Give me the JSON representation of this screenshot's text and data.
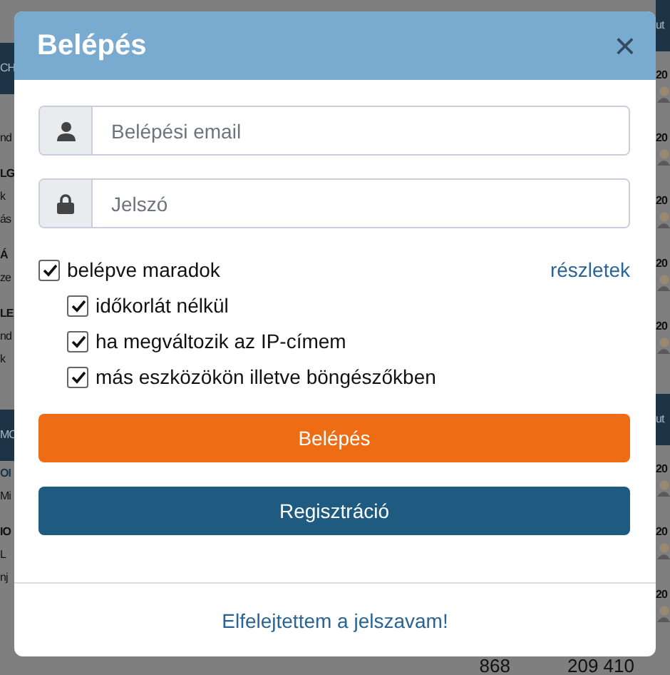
{
  "background": {
    "left": [
      {
        "kind": "header",
        "text": "CH"
      },
      {
        "kind": "line",
        "text": "nd"
      },
      {
        "kind": "title",
        "text": "LG"
      },
      {
        "kind": "line",
        "text": "k"
      },
      {
        "kind": "line",
        "text": "ás"
      },
      {
        "kind": "title",
        "text": "Á"
      },
      {
        "kind": "line",
        "text": "ze"
      },
      {
        "kind": "title",
        "text": "LE"
      },
      {
        "kind": "line",
        "text": "nd"
      },
      {
        "kind": "line",
        "text": "k"
      },
      {
        "kind": "header",
        "text": "MC"
      },
      {
        "kind": "link",
        "text": "OI"
      },
      {
        "kind": "line",
        "text": "Mi"
      },
      {
        "kind": "title",
        "text": "IO"
      },
      {
        "kind": "line",
        "text": "L"
      },
      {
        "kind": "line",
        "text": "nj"
      }
    ],
    "right": [
      {
        "kind": "header",
        "text": "ut"
      },
      {
        "kind": "entry",
        "text": "20"
      },
      {
        "kind": "entry",
        "text": "20"
      },
      {
        "kind": "entry",
        "text": "20"
      },
      {
        "kind": "entry",
        "text": "20"
      },
      {
        "kind": "entry",
        "text": "20"
      },
      {
        "kind": "header",
        "text": "ut"
      },
      {
        "kind": "entry",
        "text": "20"
      },
      {
        "kind": "entry",
        "text": "20"
      },
      {
        "kind": "entry",
        "text": "20"
      }
    ],
    "footer_numbers": [
      "868",
      "209 410"
    ]
  },
  "dialog": {
    "title": "Belépés",
    "close": "×",
    "fields": [
      {
        "kind": "user",
        "placeholder": "Belépési email"
      },
      {
        "kind": "lock",
        "placeholder": "Jelszó"
      }
    ],
    "remember": {
      "label": "belépve maradok",
      "checked": true,
      "details_link": "részletek",
      "options": [
        {
          "label": "időkorlát nélkül",
          "checked": true
        },
        {
          "label": "ha megváltozik az IP-címem",
          "checked": true
        },
        {
          "label": "más eszközökön illetve böngészőkben",
          "checked": true
        }
      ]
    },
    "buttons": [
      {
        "kind": "primary",
        "label": "Belépés"
      },
      {
        "kind": "secondary",
        "label": "Regisztráció"
      }
    ],
    "forgot_link": "Elfelejtettem a jelszavam!"
  }
}
